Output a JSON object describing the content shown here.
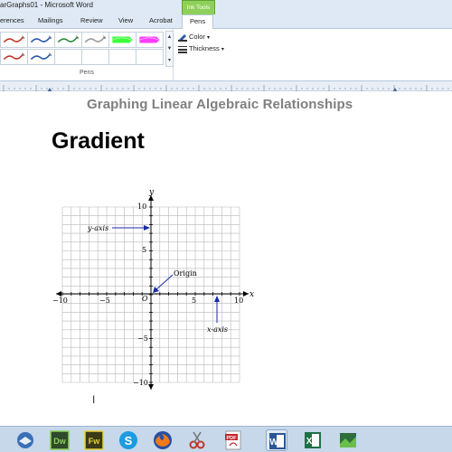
{
  "window": {
    "title": "arGraphs01  -  Microsoft Word",
    "context_tab_group": "Ink Tools"
  },
  "ribbon_tabs": [
    {
      "label": "erences",
      "active": false
    },
    {
      "label": "Mailings",
      "active": false
    },
    {
      "label": "Review",
      "active": false
    },
    {
      "label": "View",
      "active": false
    },
    {
      "label": "Acrobat",
      "active": false
    },
    {
      "label": "Pens",
      "active": true
    }
  ],
  "ribbon": {
    "pens_group_label": "Pens",
    "color_label": "Color",
    "thickness_label": "Thickness",
    "gallery_up": "▲",
    "gallery_down": "▼",
    "gallery_more": "▾",
    "pens": [
      {
        "row": 1,
        "color": "#c0392b",
        "kind": "pen"
      },
      {
        "row": 1,
        "color": "#2a5aa8",
        "kind": "pen"
      },
      {
        "row": 1,
        "color": "#2e8b3e",
        "kind": "pen"
      },
      {
        "row": 1,
        "color": "#9a9a9a",
        "kind": "pen"
      },
      {
        "row": 1,
        "color": "#3cff3c",
        "kind": "highlighter"
      },
      {
        "row": 1,
        "color": "#ff3cff",
        "kind": "highlighter"
      },
      {
        "row": 2,
        "color": "#c0392b",
        "kind": "pen"
      },
      {
        "row": 2,
        "color": "#2a5aa8",
        "kind": "pen"
      }
    ]
  },
  "document": {
    "subtitle": "Graphing Linear Algebraic Relationships",
    "heading": "Gradient",
    "cursor_glyph": "I",
    "graph": {
      "x_label": "x",
      "y_label": "y",
      "origin_letter": "O",
      "x_ticks": [
        "−10",
        "−5",
        "5",
        "10"
      ],
      "y_ticks": [
        "10",
        "5",
        "−5",
        "−10"
      ],
      "annotations": {
        "y_axis": "y-axis",
        "x_axis": "x-axis",
        "origin": "Origin"
      },
      "accent_color": "#1a2aa6"
    }
  },
  "taskbar": {
    "items": [
      {
        "name": "thunderbird-icon",
        "text": ""
      },
      {
        "name": "dreamweaver-icon",
        "text": "Dw"
      },
      {
        "name": "fireworks-icon",
        "text": "Fw"
      },
      {
        "name": "skype-icon",
        "text": "S"
      },
      {
        "name": "firefox-icon",
        "text": ""
      },
      {
        "name": "snipping-tool-icon",
        "text": ""
      },
      {
        "name": "acrobat-icon",
        "text": "PDF"
      },
      {
        "name": "word-icon",
        "text": "W"
      },
      {
        "name": "excel-icon",
        "text": "X"
      },
      {
        "name": "tray-app-icon",
        "text": ""
      }
    ]
  }
}
